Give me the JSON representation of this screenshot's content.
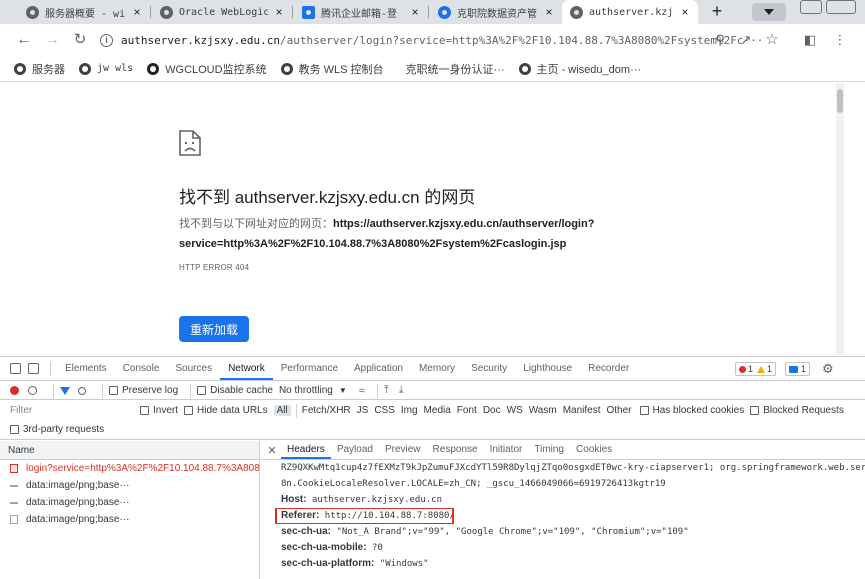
{
  "tabs": [
    {
      "title": "服务器概要 - wis",
      "active": false
    },
    {
      "title": "Oracle WebLogic",
      "active": false
    },
    {
      "title": "腾讯企业邮箱-登",
      "active": false
    },
    {
      "title": "克职院数据资产管",
      "active": false
    },
    {
      "title": "authserver.kzjs",
      "active": true
    }
  ],
  "tab_close_label": "×",
  "new_tab_label": "+",
  "address": {
    "host": "authserver.kzjsxy.edu.cn",
    "path": "/authserver/login?service=http%3A%2F%2F10.104.88.7%3A8080%2Fsystem%2Fc···",
    "info_glyph": "i"
  },
  "bookmarks": [
    {
      "label": "服务器"
    },
    {
      "label": "jw wls"
    },
    {
      "label": "WGCLOUD监控系统"
    },
    {
      "label": "教务 WLS 控制台"
    },
    {
      "label": "克职统一身份认证···"
    },
    {
      "label": "主页 - wisedu_dom···"
    }
  ],
  "error_page": {
    "title": "找不到 authserver.kzjsxy.edu.cn 的网页",
    "desc_prefix": "找不到与以下网址对应的网页：",
    "desc_url": "https://authserver.kzjsxy.edu.cn/authserver/login?service=http%3A%2F%2F10.104.88.7%3A8080%2Fsystem%2Fcaslogin.jsp",
    "error_code": "HTTP ERROR 404",
    "reload_label": "重新加载"
  },
  "devtools": {
    "main_tabs": [
      "Elements",
      "Console",
      "Sources",
      "Network",
      "Performance",
      "Application",
      "Memory",
      "Security",
      "Lighthouse",
      "Recorder"
    ],
    "active_tab": "Network",
    "error_count": "1",
    "warning_count": "1",
    "message_count": "1",
    "toolbar": {
      "preserve_log": "Preserve log",
      "disable_cache": "Disable cache",
      "throttling": "No throttling"
    },
    "filter": {
      "placeholder": "Filter",
      "invert": "Invert",
      "hide_data_urls": "Hide data URLs",
      "types": [
        "All",
        "Fetch/XHR",
        "JS",
        "CSS",
        "Img",
        "Media",
        "Font",
        "Doc",
        "WS",
        "Wasm",
        "Manifest",
        "Other"
      ],
      "blocked_cookies": "Has blocked cookies",
      "blocked_requests": "Blocked Requests",
      "third_party": "3rd-party requests"
    },
    "requests_header": "Name",
    "requests": [
      {
        "name": "login?service=http%3A%2F%2F10.104.88.7%3A8080%2F···",
        "selected": true
      },
      {
        "name": "data:image/png;base···",
        "selected": false
      },
      {
        "name": "data:image/png;base···",
        "selected": false
      },
      {
        "name": "data:image/png;base···",
        "selected": false
      }
    ],
    "detail_tabs": [
      "Headers",
      "Payload",
      "Preview",
      "Response",
      "Initiator",
      "Timing",
      "Cookies"
    ],
    "detail_active": "Headers",
    "header_lines": [
      {
        "key": "",
        "value": "RZ9QXKwMtq1cup4z7fEXMzT9kJpZumuFJXcdYTl59R8DylqjZTqo0osgxdET0wc-kry-ciapserver1; org.springframework.web.serv"
      },
      {
        "key": "",
        "value": "8n.CookieLocaleResolver.LOCALE=zh_CN; _gscu_1466049066=6919726413kgtr19"
      },
      {
        "key": "Host:",
        "value": " authserver.kzjsxy.edu.cn"
      },
      {
        "key": "Referer:",
        "value": " http://10.104.88.7:8080/"
      },
      {
        "key": "sec-ch-ua:",
        "value": " \"Not_A Brand\";v=\"99\", \"Google Chrome\";v=\"109\", \"Chromium\";v=\"109\""
      },
      {
        "key": "sec-ch-ua-mobile:",
        "value": " ?0"
      },
      {
        "key": "sec-ch-ua-platform:",
        "value": " \"Windows\""
      }
    ]
  }
}
